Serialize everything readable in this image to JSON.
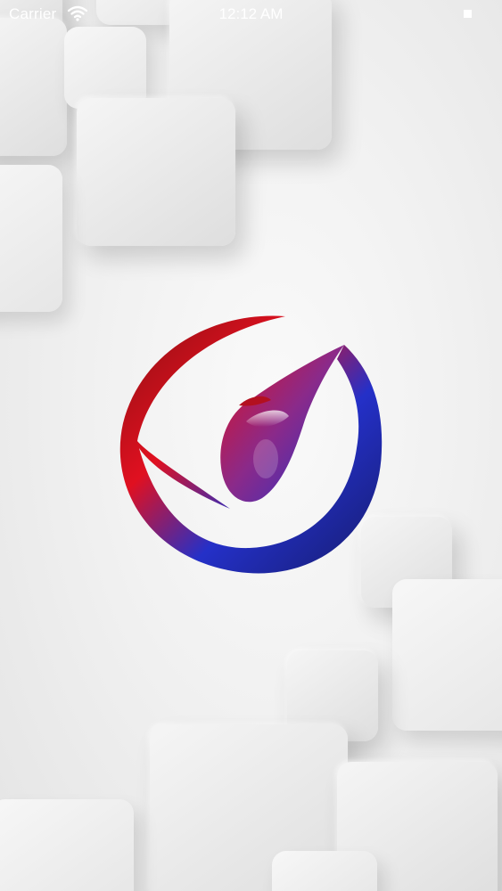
{
  "status_bar": {
    "carrier": "Carrier",
    "time": "12:12 AM",
    "wifi_icon": "wifi-icon",
    "battery_icon": "battery-icon"
  },
  "splash": {
    "logo_icon": "brand-swirl-logo",
    "colors": {
      "red": "#e01020",
      "dark_red": "#8c0f12",
      "blue": "#2430c8",
      "dark_blue": "#161c6e",
      "background": "#efefef"
    }
  }
}
